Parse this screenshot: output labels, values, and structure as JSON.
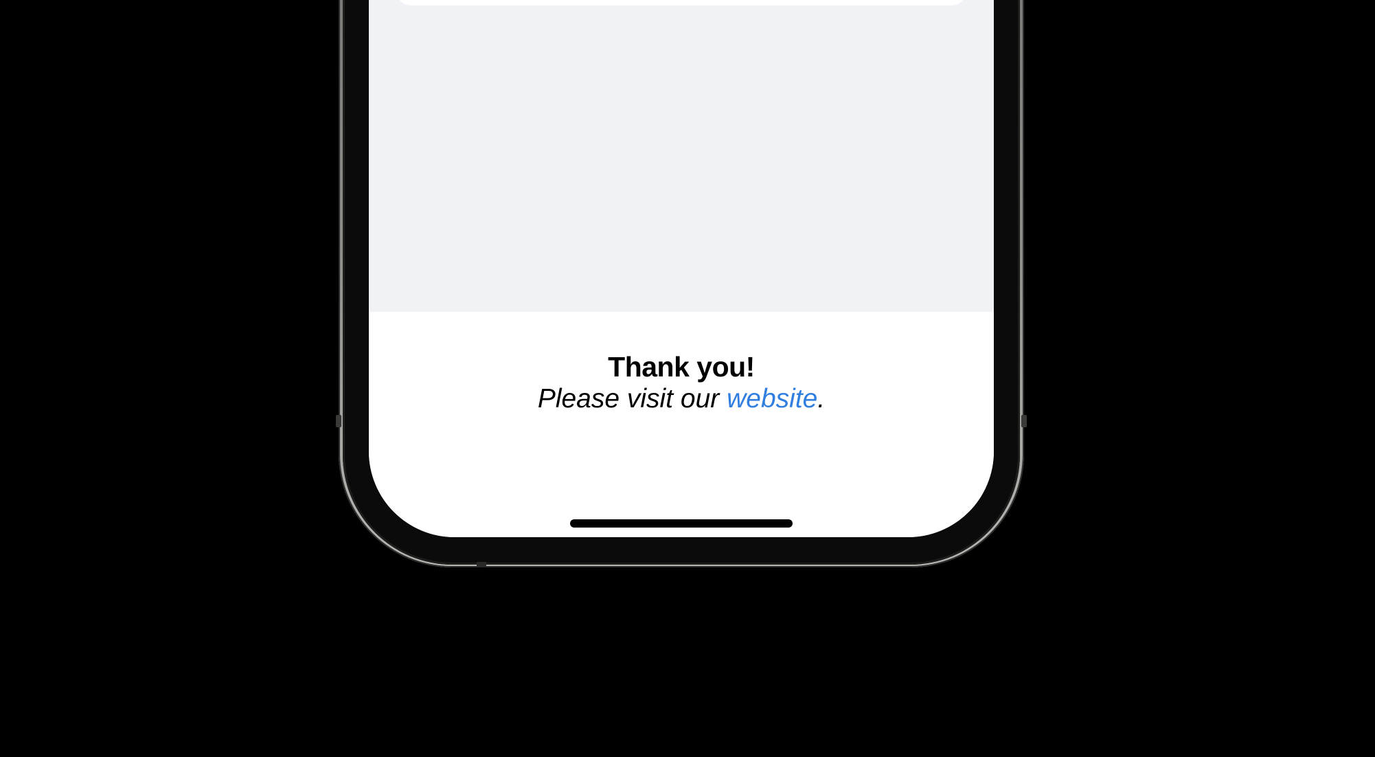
{
  "footer": {
    "thanks": "Thank you!",
    "visit_prefix": "Please visit our ",
    "link_label": "website",
    "visit_suffix": "."
  },
  "colors": {
    "link": "#2f7ee0",
    "background": "#000000",
    "grouped_background": "#f1f2f6"
  }
}
